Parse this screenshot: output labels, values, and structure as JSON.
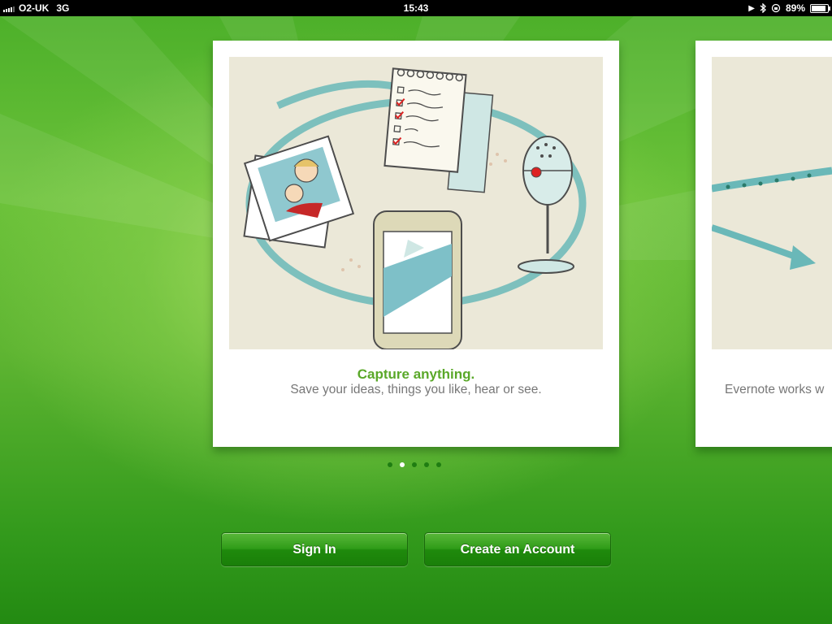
{
  "status_bar": {
    "carrier": "O2-UK",
    "network": "3G",
    "time": "15:43",
    "battery": "89%",
    "battery_level": 0.89
  },
  "slides": [
    {
      "title": "Capture anything.",
      "subtitle": "Save your ideas, things you like, hear or see."
    },
    {
      "subtitle": "Evernote works w"
    }
  ],
  "pager": {
    "count": 5,
    "active_index": 1
  },
  "buttons": {
    "sign_in": "Sign In",
    "create_account": "Create an Account"
  },
  "colors": {
    "accent_green": "#5aa829",
    "button_green": "#2f9c18",
    "illustration_bg": "#ebe8d8",
    "teal": "#6ab8b8"
  }
}
